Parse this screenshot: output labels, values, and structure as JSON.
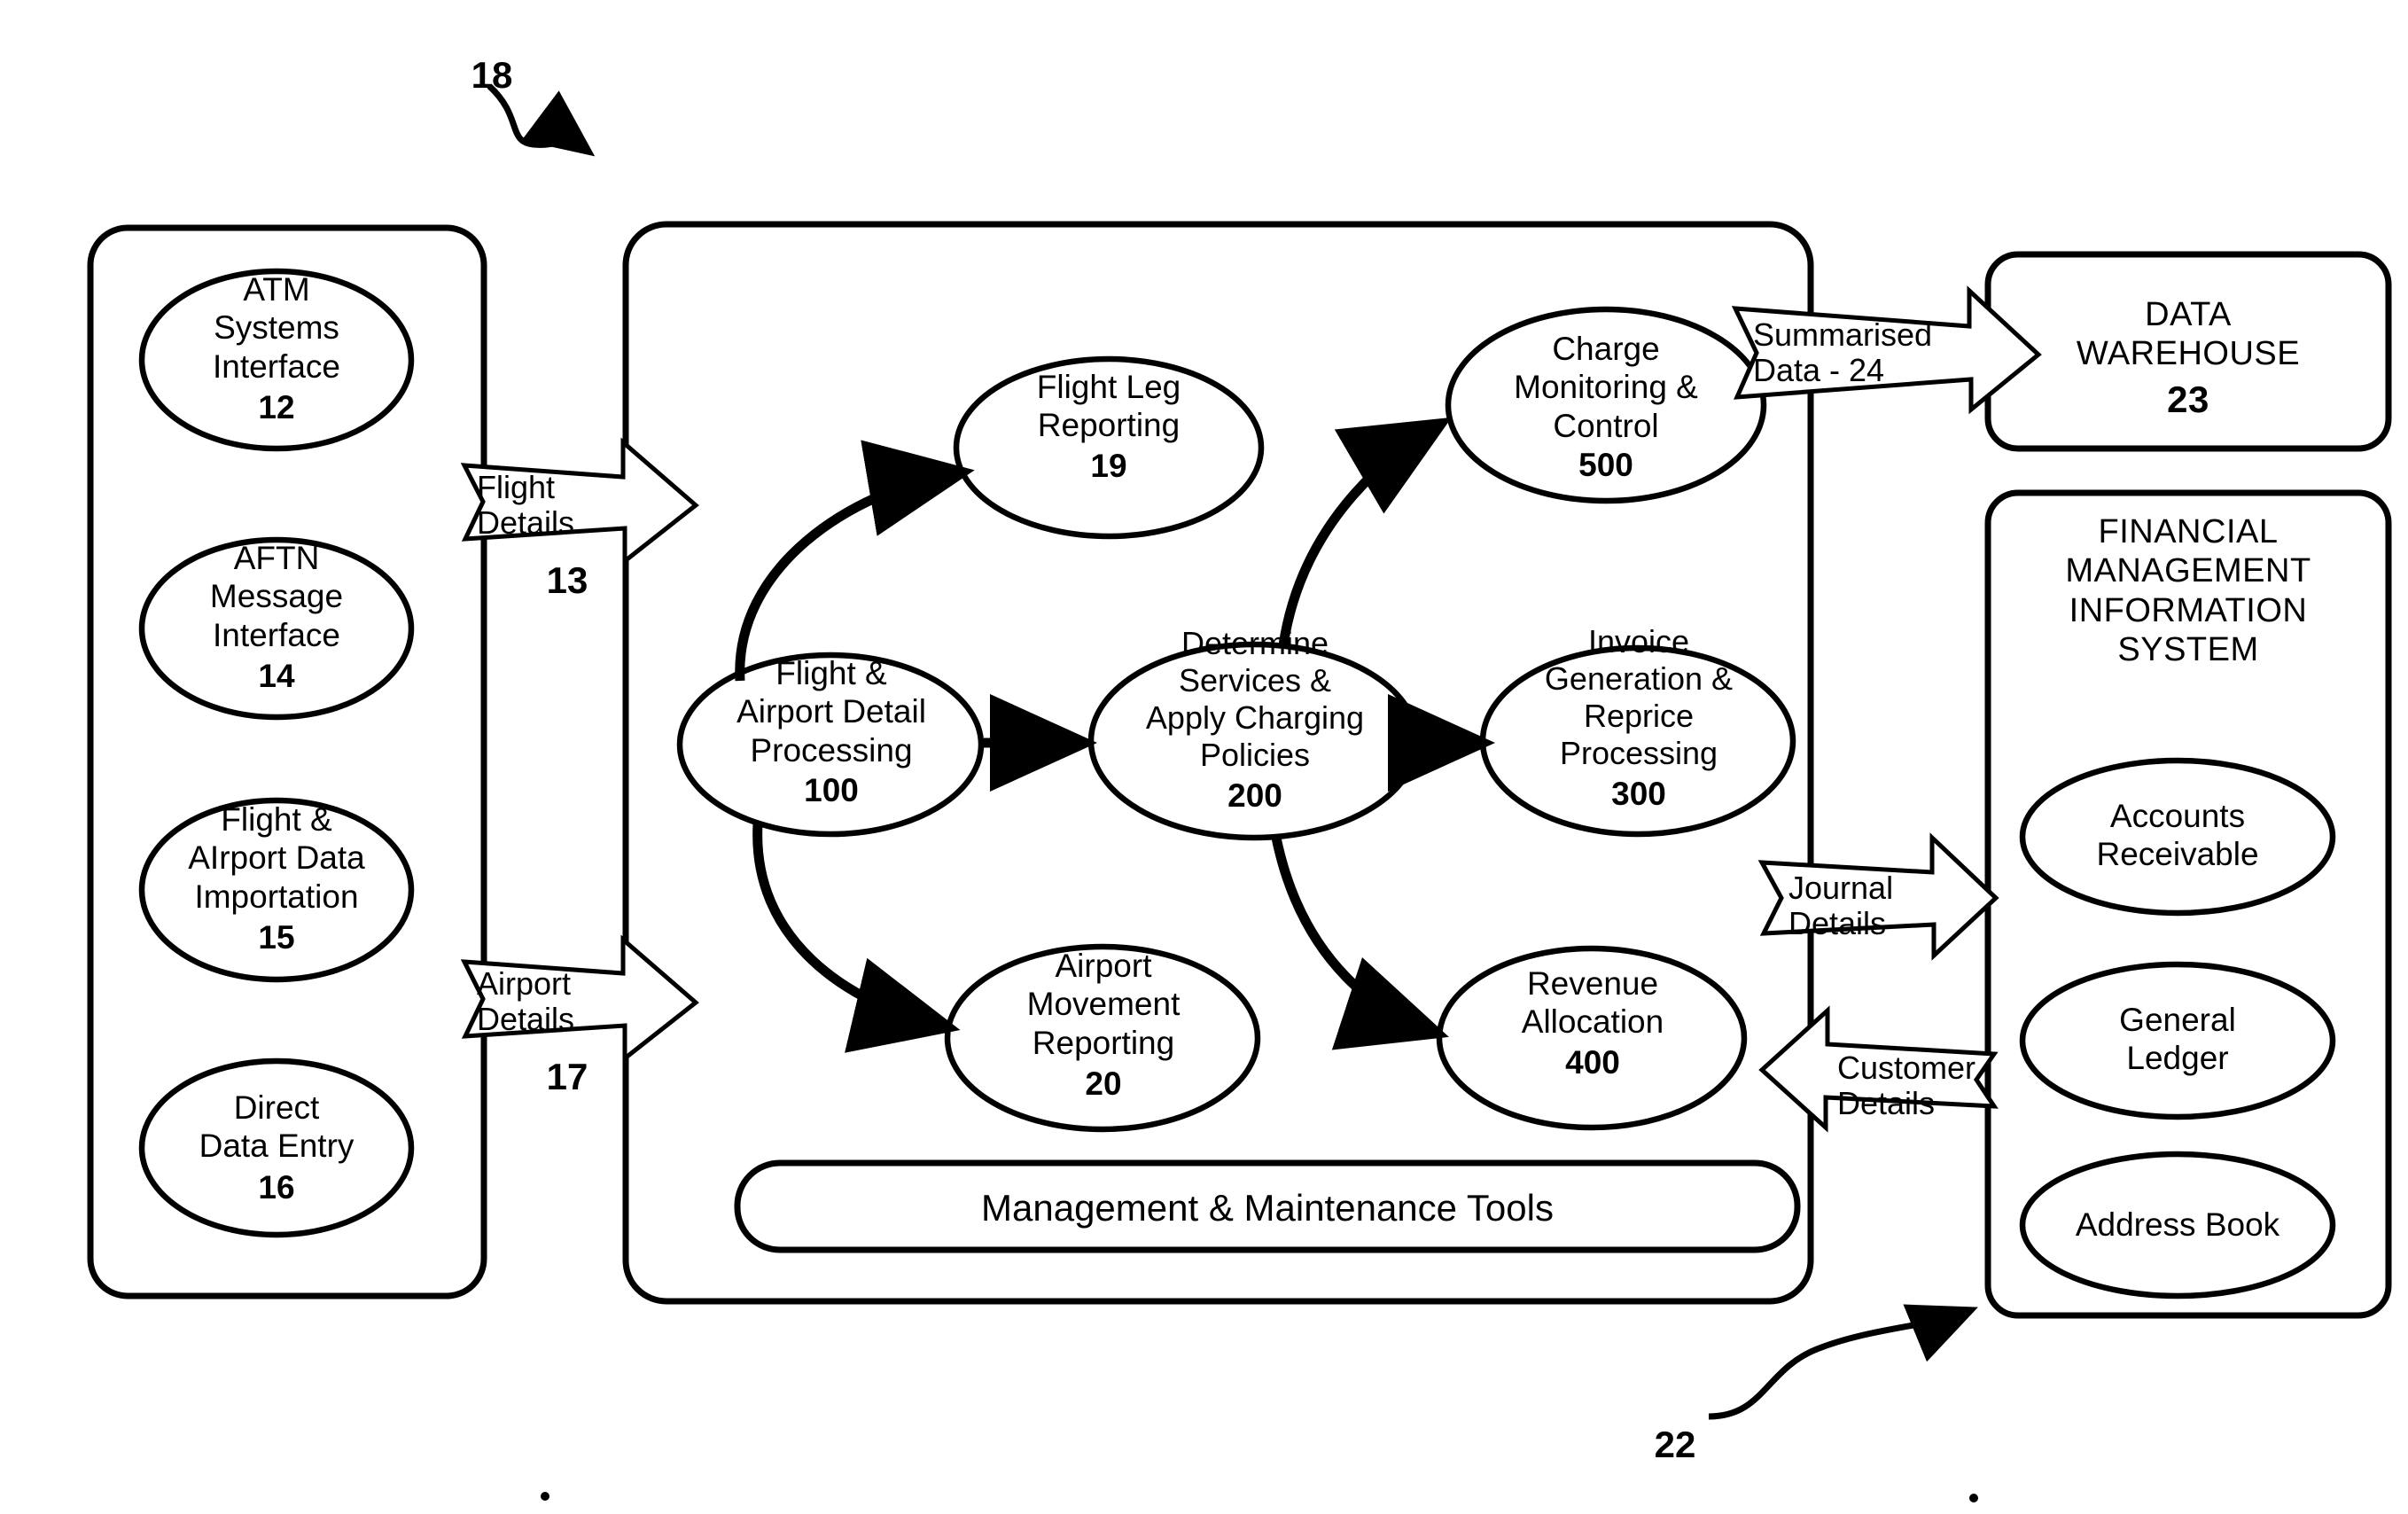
{
  "diagram": {
    "figure_ref_main": "18",
    "figure_ref_fmis": "22",
    "source_group": {
      "name": "data-sources-container",
      "nodes": [
        {
          "id": "atm",
          "lines": "ATM\nSystems\nInterface",
          "ref": "12"
        },
        {
          "id": "aftn",
          "lines": "AFTN\nMessage\nInterface",
          "ref": "14"
        },
        {
          "id": "import",
          "lines": "Flight  &\nAIrport  Data\nImportation",
          "ref": "15"
        },
        {
          "id": "direct",
          "lines": "Direct\nData  Entry",
          "ref": "16"
        }
      ]
    },
    "inbound_arrows": [
      {
        "id": "flight-details",
        "lines": "Flight\nDetails",
        "ref": "13"
      },
      {
        "id": "airport-details",
        "lines": "Airport\nDetails",
        "ref": "17"
      }
    ],
    "core_system": {
      "name": "core-processing-container",
      "nodes": [
        {
          "id": "flight-leg-reporting",
          "lines": "Flight Leg\nReporting",
          "ref": "19"
        },
        {
          "id": "charge-monitoring",
          "lines": "Charge\nMonitoring  &\nControl",
          "ref": "500"
        },
        {
          "id": "flight-airport-detail",
          "lines": "Flight  &\nAirport Detail\nProcessing",
          "ref": "100"
        },
        {
          "id": "determine-services",
          "lines": "Determine\nServices &\nApply Charging\nPolicies",
          "ref": "200"
        },
        {
          "id": "invoice-generation",
          "lines": "Invoice\nGeneration &\nReprice\nProcessing",
          "ref": "300"
        },
        {
          "id": "airport-movement",
          "lines": "Airport\nMovement\nReporting",
          "ref": "20"
        },
        {
          "id": "revenue-allocation",
          "lines": "Revenue\nAllocation",
          "ref": "400"
        }
      ],
      "banner": "Management  &  Maintenance Tools"
    },
    "outbound_arrows": [
      {
        "id": "summarised-data",
        "lines": "Summarised\nData - 24"
      },
      {
        "id": "journal-details",
        "lines": "Journal\nDetails"
      },
      {
        "id": "customer-details",
        "lines": "Customer\nDetails"
      }
    ],
    "data_warehouse": {
      "id": "data-warehouse",
      "lines": "DATA\nWAREHOUSE",
      "ref": "23"
    },
    "fmis": {
      "id": "financial-management-information-system",
      "title": "FINANCIAL\nMANAGEMENT\nINFORMATION\nSYSTEM",
      "nodes": [
        {
          "id": "accounts-receivable",
          "lines": "Accounts\nReceivable"
        },
        {
          "id": "general-ledger",
          "lines": "General\nLedger"
        },
        {
          "id": "address-book",
          "lines": "Address  Book"
        }
      ]
    },
    "colors": {
      "stroke": "#000000",
      "background": "#ffffff"
    }
  }
}
